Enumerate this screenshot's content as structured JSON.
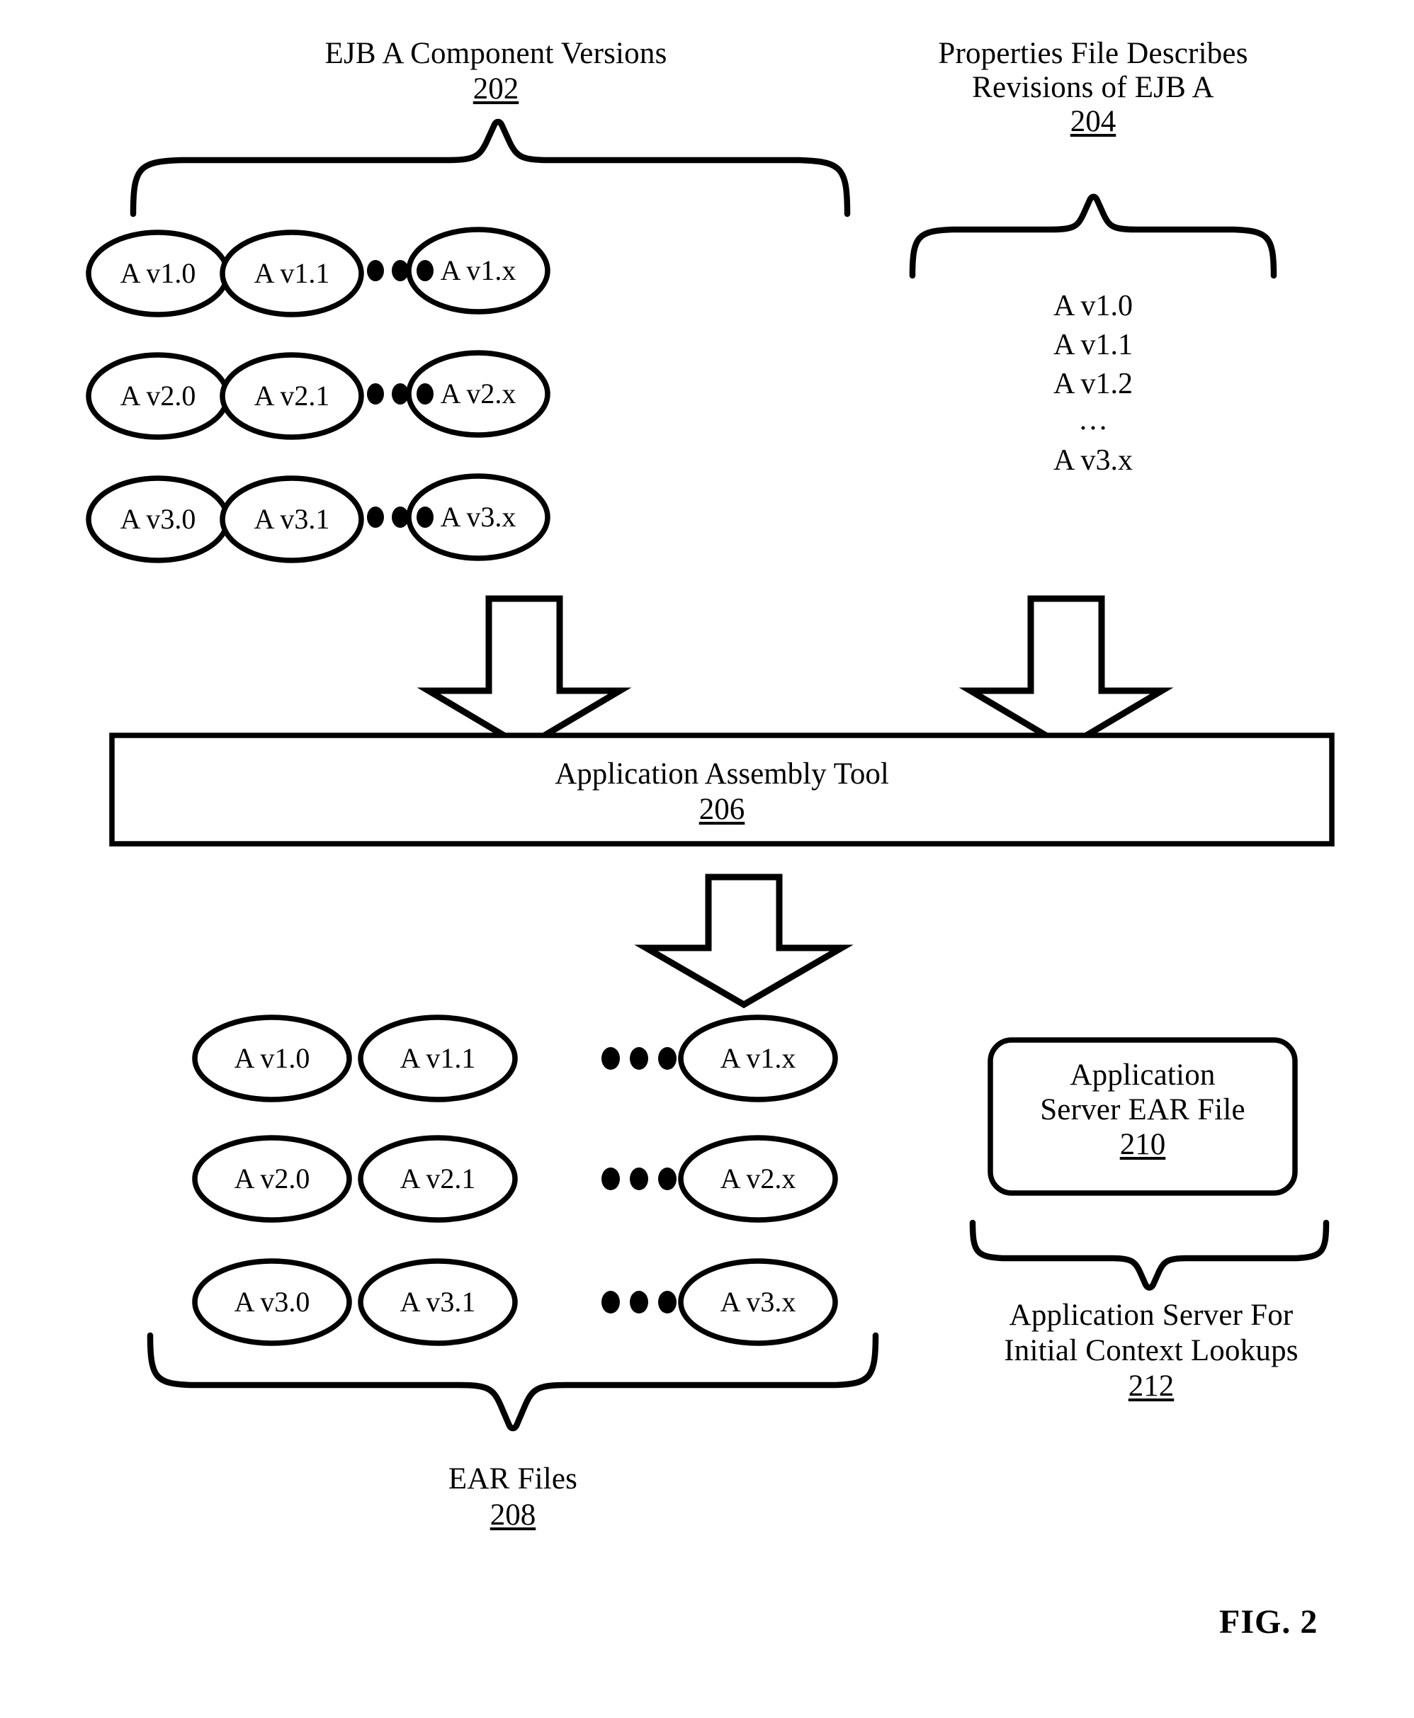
{
  "figure": {
    "label": "FIG. 2"
  },
  "headers": {
    "left": {
      "title": "EJB A Component Versions",
      "ref": "202"
    },
    "right": {
      "line1": "Properties File Describes",
      "line2": "Revisions of EJB A",
      "ref": "204"
    }
  },
  "component_versions": {
    "rows": [
      {
        "cells": [
          "A v1.0",
          "A v1.1",
          "A v1.x"
        ]
      },
      {
        "cells": [
          "A v2.0",
          "A v2.1",
          "A v2.x"
        ]
      },
      {
        "cells": [
          "A v3.0",
          "A v3.1",
          "A v3.x"
        ]
      }
    ],
    "ellipsis": "•••"
  },
  "properties_file": {
    "lines": [
      "A v1.0",
      "A v1.1",
      "A v1.2",
      "…",
      "A v3.x"
    ]
  },
  "assembly_tool": {
    "title": "Application Assembly Tool",
    "ref": "206"
  },
  "ear_outputs": {
    "rows": [
      {
        "cells": [
          "A v1.0",
          "A v1.1",
          "A v1.x"
        ]
      },
      {
        "cells": [
          "A v2.0",
          "A v2.1",
          "A v2.x"
        ]
      },
      {
        "cells": [
          "A v3.0",
          "A v3.1",
          "A v3.x"
        ]
      }
    ],
    "ellipsis": "•••",
    "caption": "EAR Files",
    "ref": "208"
  },
  "ear_file_box": {
    "line1": "Application",
    "line2": "Server EAR File",
    "ref": "210"
  },
  "app_server_caption": {
    "line1": "Application Server For",
    "line2": "Initial Context Lookups",
    "ref": "212"
  },
  "colors": {
    "ink": "#000000",
    "paper": "#ffffff"
  }
}
